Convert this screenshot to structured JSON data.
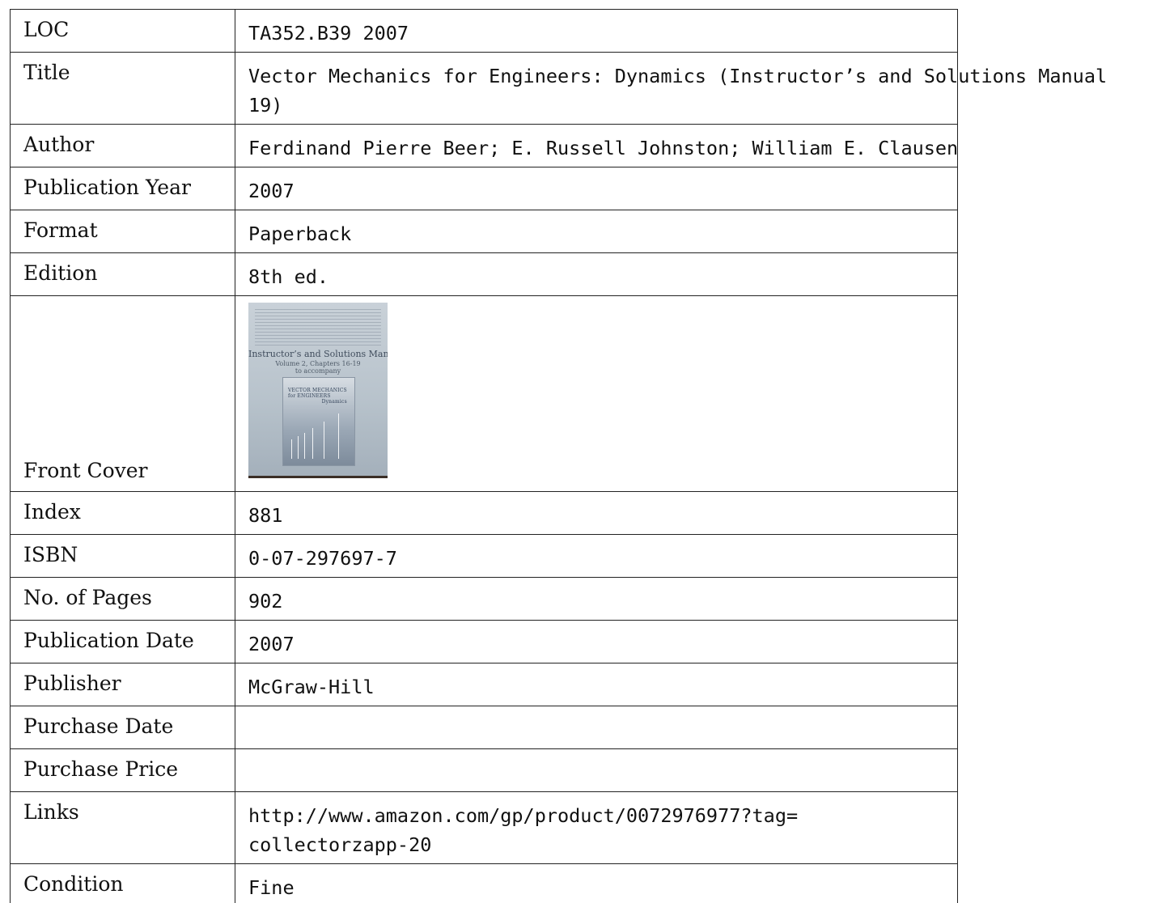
{
  "rows": [
    {
      "label": "LOC",
      "value": "TA352.B39 2007"
    },
    {
      "label": "Title",
      "value_lines": [
        "Vector Mechanics for Engineers: Dynamics (Instructor’s and Solutions Manual",
        "19)"
      ]
    },
    {
      "label": "Author",
      "value": "Ferdinand Pierre Beer; E. Russell Johnston; William E. Clausen"
    },
    {
      "label": "Publication Year",
      "value": "2007"
    },
    {
      "label": "Format",
      "value": "Paperback"
    },
    {
      "label": "Edition",
      "value": "8th ed."
    },
    {
      "label": "Front Cover"
    },
    {
      "label": "Index",
      "value": "881"
    },
    {
      "label": "ISBN",
      "value": "0-07-297697-7"
    },
    {
      "label": "No. of Pages",
      "value": "902"
    },
    {
      "label": "Publication Date",
      "value": "2007"
    },
    {
      "label": "Publisher",
      "value": "McGraw-Hill"
    },
    {
      "label": "Purchase Date",
      "value": ""
    },
    {
      "label": "Purchase Price",
      "value": ""
    },
    {
      "label": "Links",
      "value_lines": [
        "http://www.amazon.com/gp/product/0072976977?tag=",
        "collectorzapp-20"
      ]
    },
    {
      "label": "Condition",
      "value": "Fine"
    }
  ],
  "cover": {
    "heading": "Instructor’s and Solutions Manual",
    "subheading_lines": [
      "Volume 2, Chapters 16-19",
      "to accompany"
    ],
    "inner_title_lines": [
      "VECTOR MECHANICS",
      "for ENGINEERS",
      "Dynamics"
    ]
  }
}
